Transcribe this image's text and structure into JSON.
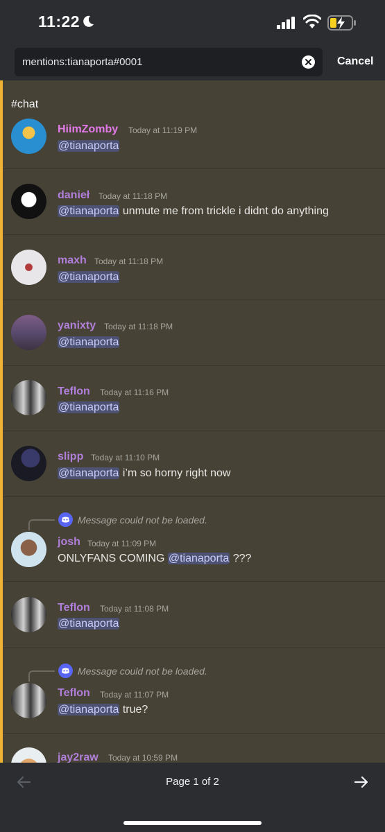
{
  "status_bar": {
    "time": "11:22",
    "icons": [
      "moon-icon",
      "signal-icon",
      "wifi-icon",
      "battery-charging-icon"
    ]
  },
  "search": {
    "query": "mentions:tianaporta#0001",
    "clear_icon": "close-circle-icon",
    "cancel_label": "Cancel"
  },
  "results": {
    "channel": "#chat",
    "messages": [
      {
        "username": "HiimZomby",
        "user_color": "#e27aea",
        "time": "Today at 11:19 PM",
        "mention": "@tianaporta",
        "text_before": "",
        "text_after": ""
      },
      {
        "username": "danieł",
        "user_color": "#b07fd9",
        "time": "Today at 11:18 PM",
        "mention": "@tianaporta",
        "text_before": "",
        "text_after": " unmute me from trickle i didnt do anything"
      },
      {
        "username": "maxh",
        "user_color": "#b07fd9",
        "time": "Today at 11:18 PM",
        "mention": "@tianaporta",
        "text_before": "",
        "text_after": ""
      },
      {
        "username": "yanixty",
        "user_color": "#b07fd9",
        "time": "Today at 11:18 PM",
        "mention": "@tianaporta",
        "text_before": "",
        "text_after": ""
      },
      {
        "username": "Teflon",
        "user_color": "#b07fd9",
        "time": "Today at 11:16 PM",
        "mention": "@tianaporta",
        "text_before": "",
        "text_after": ""
      },
      {
        "username": "slipp",
        "user_color": "#b07fd9",
        "time": "Today at 11:10 PM",
        "mention": "@tianaporta",
        "text_before": "",
        "text_after": " i’m so horny right now"
      },
      {
        "username": "josh",
        "user_color": "#b07fd9",
        "time": "Today at 11:09 PM",
        "mention": "@tianaporta",
        "text_before": "ONLYFANS COMING ",
        "text_after": " ???",
        "reply": "Message could not be loaded."
      },
      {
        "username": "Teflon",
        "user_color": "#b07fd9",
        "time": "Today at 11:08 PM",
        "mention": "@tianaporta",
        "text_before": "",
        "text_after": ""
      },
      {
        "username": "Teflon",
        "user_color": "#b07fd9",
        "time": "Today at 11:07 PM",
        "mention": "@tianaporta",
        "text_before": "",
        "text_after": " true?",
        "reply": "Message could not be loaded."
      },
      {
        "username": "jay2raw",
        "user_color": "#b07fd9",
        "time": "Today at 10:59 PM",
        "mention": "",
        "text_before": "",
        "text_after": ""
      }
    ]
  },
  "pagination": {
    "label": "Page 1 of 2",
    "prev_icon": "arrow-left-icon",
    "next_icon": "arrow-right-icon"
  },
  "colors": {
    "background": "#2b2d31",
    "results_background": "#474236",
    "accent": "#f0b232",
    "mention_bg": "#4e5272",
    "mention_text": "#c9cdfb",
    "blurple": "#5865f2"
  }
}
